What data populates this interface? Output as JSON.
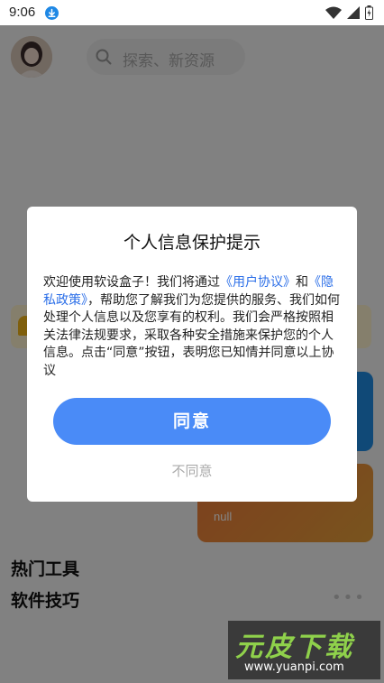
{
  "status_bar": {
    "time": "9:06"
  },
  "header": {
    "search_placeholder": "探索、新资源"
  },
  "cards": {
    "orange_card_text": "null"
  },
  "sections": {
    "hot_tools": "热门工具",
    "software_tips": "软件技巧",
    "more": "•••"
  },
  "dialog": {
    "title": "个人信息保护提示",
    "body_part1": "欢迎使用软设盒子！我们将通过",
    "user_agreement_link": "《用户协议》",
    "body_part2": "和",
    "privacy_policy_link": "《隐私政策》",
    "body_part3": "，帮助您了解我们为您提供的服务、我们如何处理个人信息以及您享有的权利。我们会严格按照相关法律法规要求，采取各种安全措施来保护您的个人信息。点击“同意”按钮，表明您已知情并同意以上协议",
    "agree_label": "同意",
    "disagree_label": "不同意"
  },
  "watermark": {
    "title": "元皮下载",
    "url": "www.yuanpi.com"
  },
  "colors": {
    "accent": "#4a8bf7",
    "link": "#2c6fe8",
    "card_blue": "#1f8ce4",
    "card_orange": "#f07a3a",
    "watermark_green": "#8fd14b"
  },
  "icons": [
    "download-icon",
    "wifi-icon",
    "signal-icon",
    "battery-icon",
    "avatar",
    "search-icon",
    "bell-icon"
  ]
}
